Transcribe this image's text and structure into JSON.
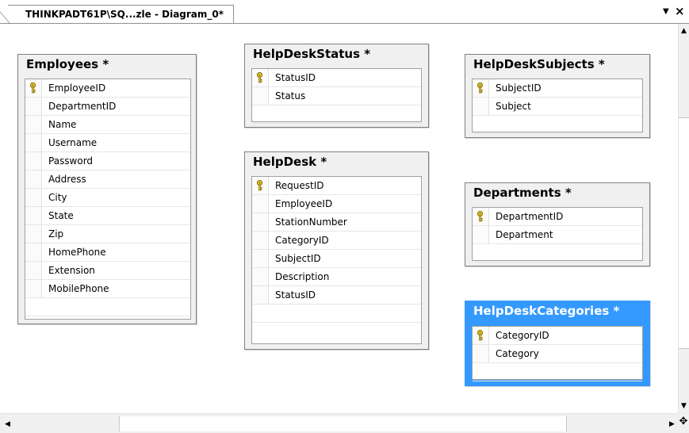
{
  "tab": {
    "title": "THINKPADT61P\\SQ...zle - Diagram_0*",
    "dropdown_icon": "chevron-down-icon",
    "close_label": "×"
  },
  "colors": {
    "selected_table": "#3399ff",
    "table_bg": "#f0f0f0",
    "key_icon": "#d8b400"
  },
  "tables": {
    "employees": {
      "title": "Employees *",
      "columns": [
        "EmployeeID",
        "DepartmentID",
        "Name",
        "Username",
        "Password",
        "Address",
        "City",
        "State",
        "Zip",
        "HomePhone",
        "Extension",
        "MobilePhone"
      ],
      "primary_key": "EmployeeID"
    },
    "helpdeskstatus": {
      "title": "HelpDeskStatus *",
      "columns": [
        "StatusID",
        "Status"
      ],
      "primary_key": "StatusID"
    },
    "helpdesksubjects": {
      "title": "HelpDeskSubjects *",
      "columns": [
        "SubjectID",
        "Subject"
      ],
      "primary_key": "SubjectID"
    },
    "helpdesk": {
      "title": "HelpDesk *",
      "columns": [
        "RequestID",
        "EmployeeID",
        "StationNumber",
        "CategoryID",
        "SubjectID",
        "Description",
        "StatusID"
      ],
      "primary_key": "RequestID"
    },
    "departments": {
      "title": "Departments *",
      "columns": [
        "DepartmentID",
        "Department"
      ],
      "primary_key": "DepartmentID"
    },
    "helpdeskcategories": {
      "title": "HelpDeskCategories *",
      "columns": [
        "CategoryID",
        "Category"
      ],
      "primary_key": "CategoryID",
      "selected": true
    }
  },
  "scrollbars": {
    "up_arrow": "▲",
    "down_arrow": "▼",
    "left_arrow": "◀",
    "right_arrow": "▶",
    "corner_icon": "move-icon"
  }
}
